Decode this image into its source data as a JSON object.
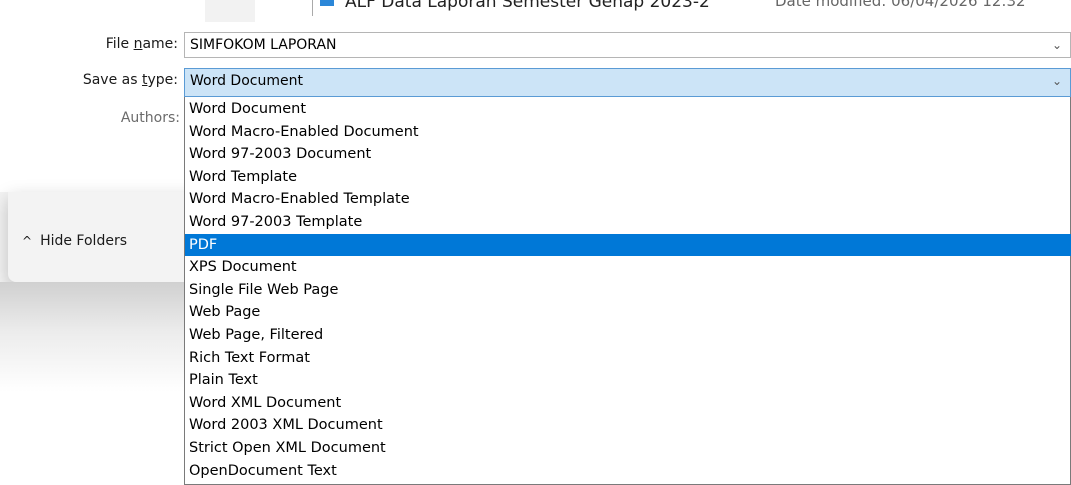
{
  "file_list": {
    "visible_row_name": "ALF Data Laporan Semester Genap 2023-2",
    "visible_row_date": "Date modified: 06/04/2026 12:32"
  },
  "form": {
    "file_name_label_prefix": "File ",
    "file_name_label_key": "n",
    "file_name_label_suffix": "ame:",
    "file_name_value": "SIMFOKOM LAPORAN",
    "save_type_label_prefix": "Save as ",
    "save_type_label_key": "t",
    "save_type_label_suffix": "ype:",
    "save_type_value": "Word Document",
    "authors_label": "Authors:"
  },
  "hide_folders": {
    "label": "Hide Folders"
  },
  "icons": {
    "dropdown_chevron": "chevron-down-icon",
    "hide_folders_caret": "chevron-up-icon"
  },
  "dropdown": {
    "selected_index": 6,
    "options": [
      "Word Document",
      "Word Macro-Enabled Document",
      "Word 97-2003 Document",
      "Word Template",
      "Word Macro-Enabled Template",
      "Word 97-2003 Template",
      "PDF",
      "XPS Document",
      "Single File Web Page",
      "Web Page",
      "Web Page, Filtered",
      "Rich Text Format",
      "Plain Text",
      "Word XML Document",
      "Word 2003 XML Document",
      "Strict Open XML Document",
      "OpenDocument Text"
    ]
  },
  "colors": {
    "selection": "#0078d7",
    "select_field_bg": "#cce4f7",
    "panel_bg": "#f3f3f3"
  }
}
